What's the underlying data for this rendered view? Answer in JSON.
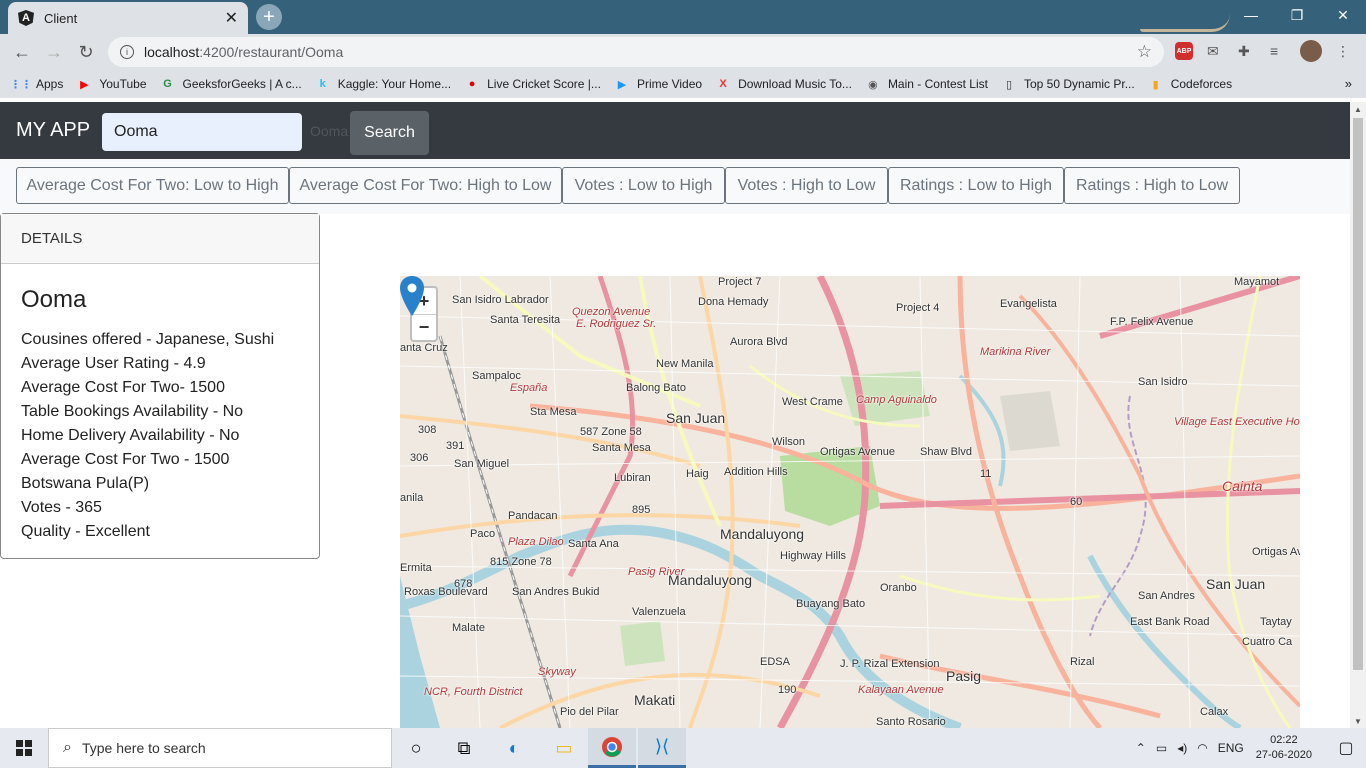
{
  "browser": {
    "tab_title": "Client",
    "url_host": "localhost",
    "url_rest": ":4200/restaurant/Ooma",
    "bookmarks": [
      {
        "label": "Apps",
        "icon": "apps-grid-icon",
        "color": "#4285f4"
      },
      {
        "label": "YouTube",
        "icon": "youtube-icon",
        "color": "#ff0000"
      },
      {
        "label": "GeeksforGeeks | A c...",
        "icon": "gfg-icon",
        "color": "#2f8d46"
      },
      {
        "label": "Kaggle: Your Home...",
        "icon": "kaggle-icon",
        "color": "#20beff"
      },
      {
        "label": "Live Cricket Score |...",
        "icon": "cricket-icon",
        "color": "#d00"
      },
      {
        "label": "Prime Video",
        "icon": "prime-video-icon",
        "color": "#1a98ff"
      },
      {
        "label": "Download Music To...",
        "icon": "music-x-icon",
        "color": "#e33"
      },
      {
        "label": "Main - Contest List",
        "icon": "globe-icon",
        "color": "#555"
      },
      {
        "label": "Top 50 Dynamic Pr...",
        "icon": "page-icon",
        "color": "#333"
      },
      {
        "label": "Codeforces",
        "icon": "codeforces-icon",
        "color": "#f5a623"
      }
    ],
    "more_bookmarks": "»"
  },
  "app": {
    "brand": "MY APP",
    "search_value": "Ooma",
    "ghost_text": "Ooma",
    "search_button": "Search"
  },
  "sort_buttons": [
    "Average Cost For Two: Low to High",
    "Average Cost For Two: High to Low",
    "Votes : Low to High",
    "Votes : High to Low",
    "Ratings : Low to High",
    "Ratings : High to Low"
  ],
  "details": {
    "header": "DETAILS",
    "name": "Ooma",
    "lines": [
      "Cousines offered - Japanese, Sushi",
      "Average User Rating - 4.9",
      "Average Cost For Two- 1500",
      "Table Bookings Availability - No",
      "Home Delivery Availability - No",
      "Average Cost For Two - 1500 Botswana Pula(P)",
      "Votes - 365",
      "Quality - Excellent"
    ]
  },
  "map": {
    "zoom_in": "+",
    "zoom_out": "−",
    "marker_color": "#2a81cb",
    "labels": [
      "San Isidro Labrador",
      "Santa Teresita",
      "Quezon Avenue",
      "E. Rodriguez Sr.",
      "Project 4",
      "anta Cruz",
      "New Manila",
      "Sampaloc",
      "España",
      "Balong Bato",
      "San Juan",
      "West Crame",
      "Camp Aguinaldo",
      "San Isidro",
      "587 Zone 58",
      "Santa Mesa",
      "308",
      "391",
      "306",
      "San Miguel",
      "Addition Hills",
      "Wilson",
      "Ortigas Avenue",
      "11",
      "60",
      "Village East Executive Homes",
      "Cainta",
      "anila",
      "Pandacan",
      "895",
      "Mandaluyong",
      "Plaza Dilao",
      "Paco",
      "Santa Ana",
      "Highway Hills",
      "815 Zone 78",
      "Ermita",
      "678",
      "Pasig River",
      "Mandaluyong",
      "Oranbo",
      "Pasig",
      "San Andres Bukid",
      "Valenzuela",
      "Buayang Bato",
      "San Andres",
      "San Juan",
      "Taytay",
      "Cuatro Ca",
      "Malate",
      "Skyway",
      "EDSA",
      "J. P. Rizal Extension",
      "190",
      "Makati",
      "Kalayaan Avenue",
      "Pio del Pilar",
      "Santo Rosario",
      "NCR, Fourth District",
      "Roxas Boulevard",
      "East Bank Road",
      "Marikina River",
      "Evangelista",
      "Ortigas Ave",
      "Lubiran",
      "Haig",
      "Mayamot",
      "Project 7",
      "F.P. Felix Avenue",
      "Dona Hemady",
      "Aurora Blvd",
      "Shaw Blvd",
      "Sta Mesa",
      "Rizal",
      "Calax"
    ]
  },
  "taskbar": {
    "search_placeholder": "Type here to search",
    "lang": "ENG",
    "time": "02:22",
    "date": "27-06-2020"
  }
}
